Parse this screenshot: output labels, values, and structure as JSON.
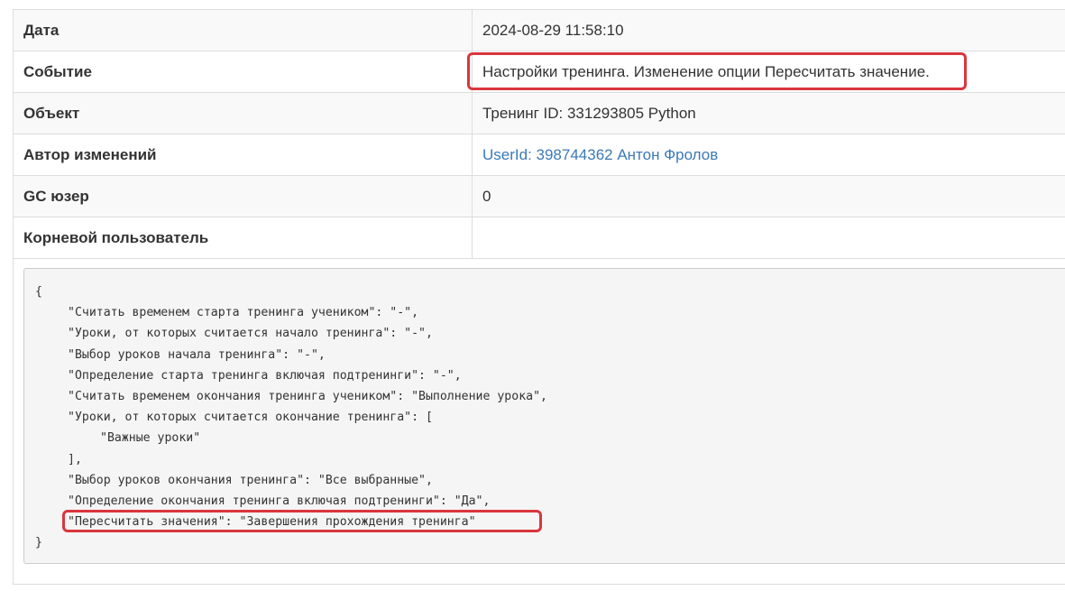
{
  "rows": [
    {
      "label": "Дата",
      "value": "2024-08-29 11:58:10"
    },
    {
      "label": "Событие",
      "value": "Настройки тренинга. Изменение опции Пересчитать значение."
    },
    {
      "label": "Объект",
      "value": "Тренинг ID: 331293805 Python"
    },
    {
      "label": "Автор изменений",
      "value": "UserId: 398744362 Антон Фролов"
    },
    {
      "label": "GC юзер",
      "value": "0"
    },
    {
      "label": "Корневой пользователь",
      "value": ""
    }
  ],
  "code": {
    "open_brace": "{",
    "lines": [
      "\"Считать временем старта тренинга учеником\": \"-\",",
      "\"Уроки, от которых считается начало тренинга\": \"-\",",
      "\"Выбор уроков начала тренинга\": \"-\",",
      "\"Определение старта тренинга включая подтренинги\": \"-\",",
      "\"Считать временем окончания тренинга учеником\": \"Выполнение урока\",",
      "\"Уроки, от которых считается окончание тренинга\": ["
    ],
    "nested_item": "\"Важные уроки\"",
    "close_bracket": "],",
    "lines_after": [
      "\"Выбор уроков окончания тренинга\": \"Все выбранные\",",
      "\"Определение окончания тренинга включая подтренинги\": \"Да\","
    ],
    "highlighted_line": "\"Пересчитать значения\": \"Завершения прохождения тренинга\"",
    "close_brace": "}"
  },
  "colors": {
    "highlight": "#d9363e",
    "link": "#3b79b8",
    "stripe": "#f9f9f9",
    "code_bg": "#f5f5f5"
  }
}
